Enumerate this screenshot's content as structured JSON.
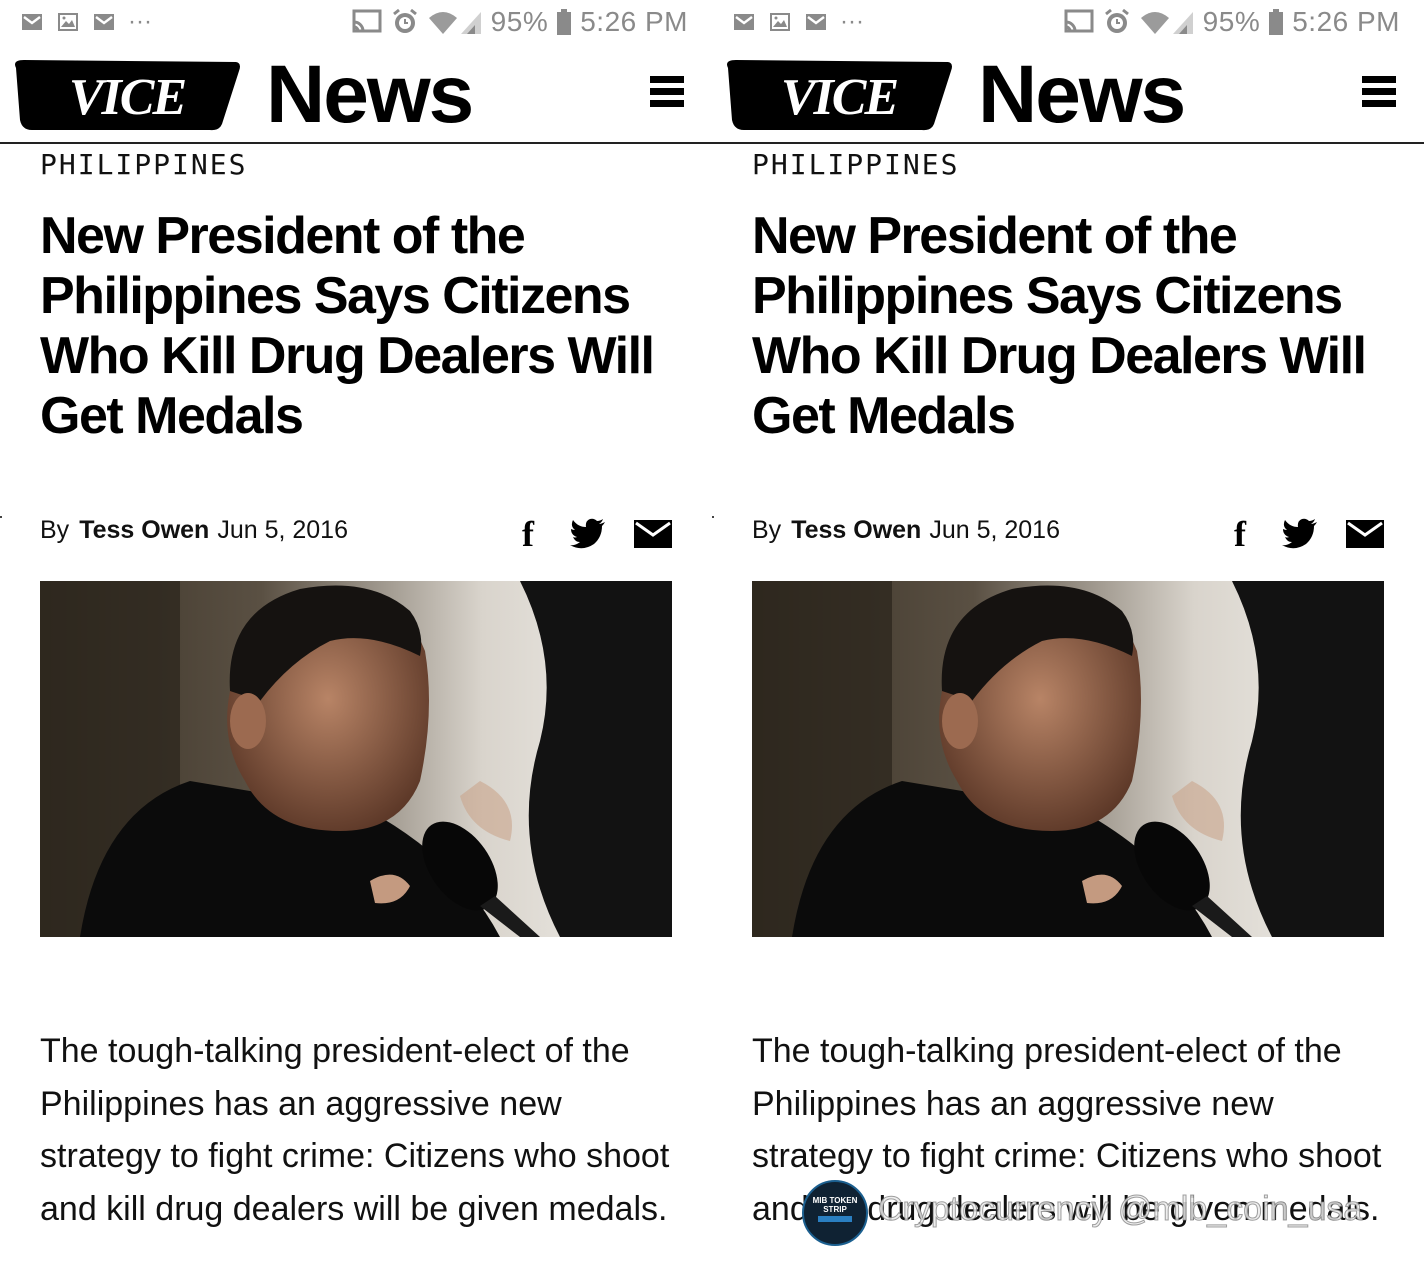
{
  "status_bar": {
    "more_indicator": "···",
    "battery": "95%",
    "time": "5:26 PM"
  },
  "header": {
    "logo_text": "VICE",
    "section_title": "News",
    "menu_icon": "hamburger-menu-icon"
  },
  "article": {
    "category": "PHILIPPINES",
    "headline": "New President of the Philippines Says Citizens Who Kill Drug Dealers Will Get Medals",
    "by_prefix": "By",
    "author": "Tess Owen",
    "date": "Jun 5, 2016",
    "share_icons": [
      "facebook-icon",
      "twitter-icon",
      "email-icon"
    ],
    "facebook_glyph": "f",
    "body": "The tough-talking president-elect of the Philippines has an aggressive new strategy to fight crime: Citizens who shoot and kill drug dealers will be given medals."
  },
  "watermark": {
    "text": "Cryptocurrency @mlb_coin_usa",
    "badge_text": "MIB TOKEN STRIP"
  }
}
